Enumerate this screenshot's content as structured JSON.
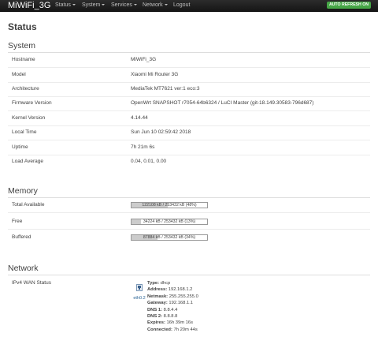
{
  "navbar": {
    "brand": "MiWiFi_3G",
    "menu": [
      {
        "label": "Status",
        "has_dropdown": true
      },
      {
        "label": "System",
        "has_dropdown": true
      },
      {
        "label": "Services",
        "has_dropdown": true
      },
      {
        "label": "Network",
        "has_dropdown": true
      },
      {
        "label": "Logout",
        "has_dropdown": false
      }
    ],
    "auto_refresh": "AUTO REFRESH ON",
    "auto_refresh_color": "#46a546"
  },
  "page_title": "Status",
  "system": {
    "title": "System",
    "rows": [
      {
        "label": "Hostname",
        "value": "MiWiFi_3G"
      },
      {
        "label": "Model",
        "value": "Xiaomi Mi Router 3G"
      },
      {
        "label": "Architecture",
        "value": "MediaTek MT7621 ver:1 eco:3"
      },
      {
        "label": "Firmware Version",
        "value": "OpenWrt SNAPSHOT r7054-64b6324 / LuCI Master (git-18.149.30583-796d687)"
      },
      {
        "label": "Kernel Version",
        "value": "4.14.44"
      },
      {
        "label": "Local Time",
        "value": "Sun Jun 10 02:59:42 2018"
      },
      {
        "label": "Uptime",
        "value": "7h 21m 6s"
      },
      {
        "label": "Load Average",
        "value": "0.04, 0.01, 0.00"
      }
    ]
  },
  "memory": {
    "title": "Memory",
    "rows": [
      {
        "label": "Total Available",
        "text": "122108 kB / 253432 kB (48%)",
        "fraction": 0.48
      },
      {
        "label": "Free",
        "text": "34224 kB / 253432 kB (13%)",
        "fraction": 0.13
      },
      {
        "label": "Buffered",
        "text": "87884 kB / 253432 kB (34%)",
        "fraction": 0.34
      }
    ]
  },
  "network": {
    "title": "Network",
    "wan_label": "IPv4 WAN Status",
    "interface": "eth0.2",
    "interface_icon": "ethernet-port-icon",
    "details": [
      {
        "key": "Type:",
        "value": "dhcp"
      },
      {
        "key": "Address:",
        "value": "192.168.1.2"
      },
      {
        "key": "Netmask:",
        "value": "255.255.255.0"
      },
      {
        "key": "Gateway:",
        "value": "192.168.1.1"
      },
      {
        "key": "DNS 1:",
        "value": "8.8.4.4"
      },
      {
        "key": "DNS 2:",
        "value": "8.8.8.8"
      },
      {
        "key": "Expires:",
        "value": "16h 39m 16s"
      },
      {
        "key": "Connected:",
        "value": "7h 20m 44s"
      }
    ]
  }
}
